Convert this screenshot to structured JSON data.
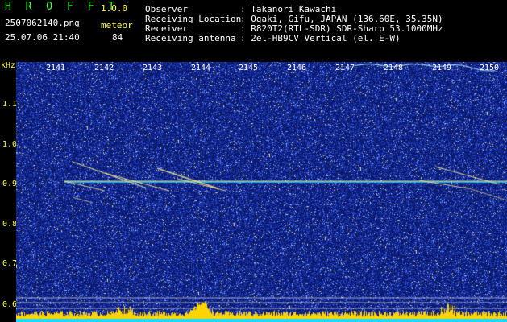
{
  "header": {
    "app_name": "H R O F F T",
    "version": "1.0.0",
    "file_name": "2507062140.png",
    "timestamp": "25.07.06 21:40",
    "meteor_label": "meteor",
    "meteor_count": "84",
    "rows": [
      {
        "label": "Observer",
        "value": ": Takanori Kawachi"
      },
      {
        "label": "Receiving Location",
        "value": ": Ogaki, Gifu, JAPAN (136.60E, 35.35N)"
      },
      {
        "label": "Receiver",
        "value": ": R820T2(RTL-SDR) SDR-Sharp 53.1000MHz"
      },
      {
        "label": "Receiving antenna",
        "value": ": 2el-HB9CV Vertical (el. E-W)"
      }
    ]
  },
  "spectrogram": {
    "y_unit": "kHz",
    "y_ticks": [
      "1.1",
      "1.0",
      "0.9",
      "0.8",
      "0.7",
      "0.6"
    ],
    "x_ticks": [
      "2141",
      "2142",
      "2143",
      "2144",
      "2145",
      "2146",
      "2147",
      "2148",
      "2149",
      "2150"
    ],
    "carrier_khz": 0.9,
    "colors": {
      "background": "#0a1a6e",
      "noise": "#2f4fe0",
      "trace": "#fff27a",
      "activity": "#ffd400",
      "baseline": "#1fd8ff"
    }
  }
}
